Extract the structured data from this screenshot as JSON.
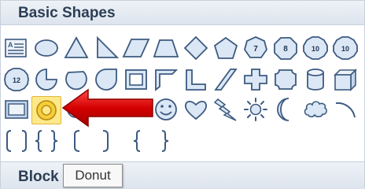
{
  "sections": {
    "basic_shapes_title": "Basic Shapes",
    "block_title": "Block"
  },
  "shapes": [
    {
      "icon": "text-box-icon",
      "selected": false
    },
    {
      "icon": "oval-icon",
      "selected": false
    },
    {
      "icon": "isosceles-triangle-icon",
      "selected": false
    },
    {
      "icon": "right-triangle-icon",
      "selected": false
    },
    {
      "icon": "parallelogram-icon",
      "selected": false
    },
    {
      "icon": "trapezoid-icon",
      "selected": false
    },
    {
      "icon": "diamond-icon",
      "selected": false
    },
    {
      "icon": "pentagon-icon",
      "selected": false
    },
    {
      "icon": "heptagon-icon",
      "label": "7",
      "selected": false
    },
    {
      "icon": "octagon-icon",
      "label": "8",
      "selected": false
    },
    {
      "icon": "decagon-icon",
      "label": "10",
      "selected": false
    },
    {
      "icon": "dodecagon-icon",
      "label": "12",
      "selected": false
    },
    {
      "icon": "pie-icon",
      "selected": false
    },
    {
      "icon": "chord-icon",
      "selected": false
    },
    {
      "icon": "teardrop-icon",
      "selected": false
    },
    {
      "icon": "frame-icon",
      "selected": false
    },
    {
      "icon": "half-frame-icon",
      "selected": false
    },
    {
      "icon": "l-shape-icon",
      "selected": false
    },
    {
      "icon": "diagonal-stripe-icon",
      "selected": false
    },
    {
      "icon": "cross-icon",
      "selected": false
    },
    {
      "icon": "plaque-icon",
      "selected": false
    },
    {
      "icon": "can-icon",
      "selected": false
    },
    {
      "icon": "cube-icon",
      "selected": false
    },
    {
      "icon": "bevel-icon",
      "selected": false
    },
    {
      "icon": "donut-icon",
      "selected": true
    },
    {
      "icon": "smiley-face-icon",
      "selected": false
    },
    {
      "icon": "heart-icon",
      "selected": false
    },
    {
      "icon": "lightning-bolt-icon",
      "selected": false
    },
    {
      "icon": "sun-icon",
      "selected": false
    },
    {
      "icon": "moon-icon",
      "selected": false
    },
    {
      "icon": "cloud-icon",
      "selected": false
    },
    {
      "icon": "arc-icon",
      "selected": false
    },
    {
      "icon": "double-bracket-icon",
      "selected": false
    },
    {
      "icon": "double-brace-icon",
      "selected": false
    },
    {
      "icon": "left-bracket-icon",
      "selected": false
    },
    {
      "icon": "right-bracket-icon",
      "selected": false
    },
    {
      "icon": "left-brace-icon",
      "selected": false
    },
    {
      "icon": "right-brace-icon",
      "selected": false
    }
  ],
  "tooltip": {
    "text": "Donut"
  },
  "callout": {
    "icon": "red-arrow-icon",
    "color": "#d40000"
  },
  "colors": {
    "shape_fill": "#dbe7f5",
    "shape_stroke": "#3d5a80",
    "selected_background": "#fde98a",
    "header_background": "#e3e9f1"
  }
}
